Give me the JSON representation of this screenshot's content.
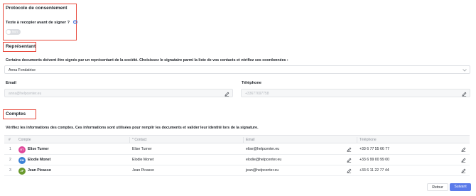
{
  "consent": {
    "title": "Protocole de consentement",
    "question": "Texte à recopier avant de signer ?",
    "toggle_label": "Non"
  },
  "representative": {
    "title": "Représentant",
    "description": "Certains documents doivent être signés par un représentant de la société. Choisissez le signataire parmi la liste de vos contacts et vérifiez ses coordonnées :",
    "selected": "Anna Fondatrice",
    "email_label": "Email",
    "email_placeholder": "anna@helpcenter.eu",
    "phone_label": "Téléphone",
    "phone_placeholder": "+33677697758"
  },
  "accounts": {
    "title": "Comptes",
    "description": "Vérifiez les informations des comptes. Ces informations sont utilisées pour remplir les documents et valider leur identité lors de la signature.",
    "columns": [
      "#",
      "Compte",
      "* Contact",
      "Email",
      "Téléphone"
    ],
    "rows": [
      {
        "index": "1",
        "initials": "ET",
        "avatar_color": "#e0489a",
        "account": "Elise Turner",
        "contact": "Elise Turner",
        "email": "elise@helpcenter.eu",
        "phone": "+33 6 77 55 66 77"
      },
      {
        "index": "2",
        "initials": "EM",
        "avatar_color": "#3b82d6",
        "account": "Elodie Monet",
        "contact": "Elodie Monet",
        "email": "elodie@helpcenter.eu",
        "phone": "+33 6 99 00 99 00"
      },
      {
        "index": "3",
        "initials": "JP",
        "avatar_color": "#6a9a2e",
        "account": "Jean Picasso",
        "contact": "Jean Picasso",
        "email": "jean@helpcenter.eu",
        "phone": "+33 6 11 22 77 44"
      }
    ]
  },
  "footer": {
    "back_label": "Retour",
    "next_label": "Suivant"
  },
  "colors": {
    "accent": "#5b7bea",
    "highlight_box": "#e8493c"
  }
}
